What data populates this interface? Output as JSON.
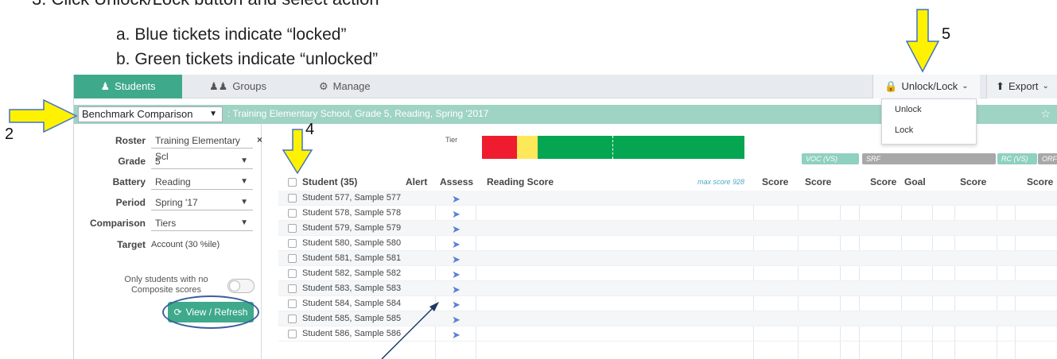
{
  "doc": {
    "step_line": "3.  Click Unlock/Lock button and select action",
    "item_a": "a.   Blue tickets indicate “locked”",
    "item_b": "b.   Green tickets indicate “unlocked”"
  },
  "callouts": {
    "c2": "2",
    "c4": "4",
    "c5": "5"
  },
  "nav": {
    "tabs": [
      {
        "label": "Students",
        "icon": "user-icon"
      },
      {
        "label": "Groups",
        "icon": "users-icon"
      },
      {
        "label": "Manage",
        "icon": "gears-icon"
      }
    ],
    "unlock_lock": "Unlock/Lock",
    "export": "Export"
  },
  "dropdown": {
    "items": [
      "Unlock",
      "Lock"
    ]
  },
  "assessment_bar": {
    "selected": "Benchmark Comparison",
    "subtitle": ": Training Elementary School, Grade 5, Reading, Spring '2017"
  },
  "filters": {
    "roster_label": "Roster",
    "roster_value": "Training Elementary Scl",
    "grade_label": "Grade",
    "grade_value": "5",
    "battery_label": "Battery",
    "battery_value": "Reading",
    "period_label": "Period",
    "period_value": "Spring '17",
    "comparison_label": "Comparison",
    "comparison_value": "Tiers",
    "target_label": "Target",
    "target_value": "Account (30 %ile)",
    "toggle_label": "Only students with no Composite scores",
    "view_refresh": "View / Refresh"
  },
  "tier": {
    "label": "Tier",
    "colors": [
      "#ee1c2e",
      "#fde85a",
      "#06a552"
    ]
  },
  "col_tags": [
    "VOC (VS)",
    "SRF",
    "RC (VS)",
    "ORF"
  ],
  "columns": {
    "student": "Student (35)",
    "alert": "Alert",
    "assess": "Assess",
    "reading_score": "Reading Score",
    "max_score": "max score 928",
    "score1": "Score",
    "score2": "Score",
    "score3": "Score",
    "goal": "Goal",
    "score4": "Score",
    "score5": "Score"
  },
  "students": [
    "Student 577, Sample 577",
    "Student 578, Sample 578",
    "Student 579, Sample 579",
    "Student 580, Sample 580",
    "Student 581, Sample 581",
    "Student 582, Sample 582",
    "Student 583, Sample 583",
    "Student 584, Sample 584",
    "Student 585, Sample 585",
    "Student 586, Sample 586"
  ],
  "colors": {
    "brand_green": "#3fa98c",
    "ticket_locked": "#5b7fd6",
    "annotation_yellow": "#fff200"
  }
}
